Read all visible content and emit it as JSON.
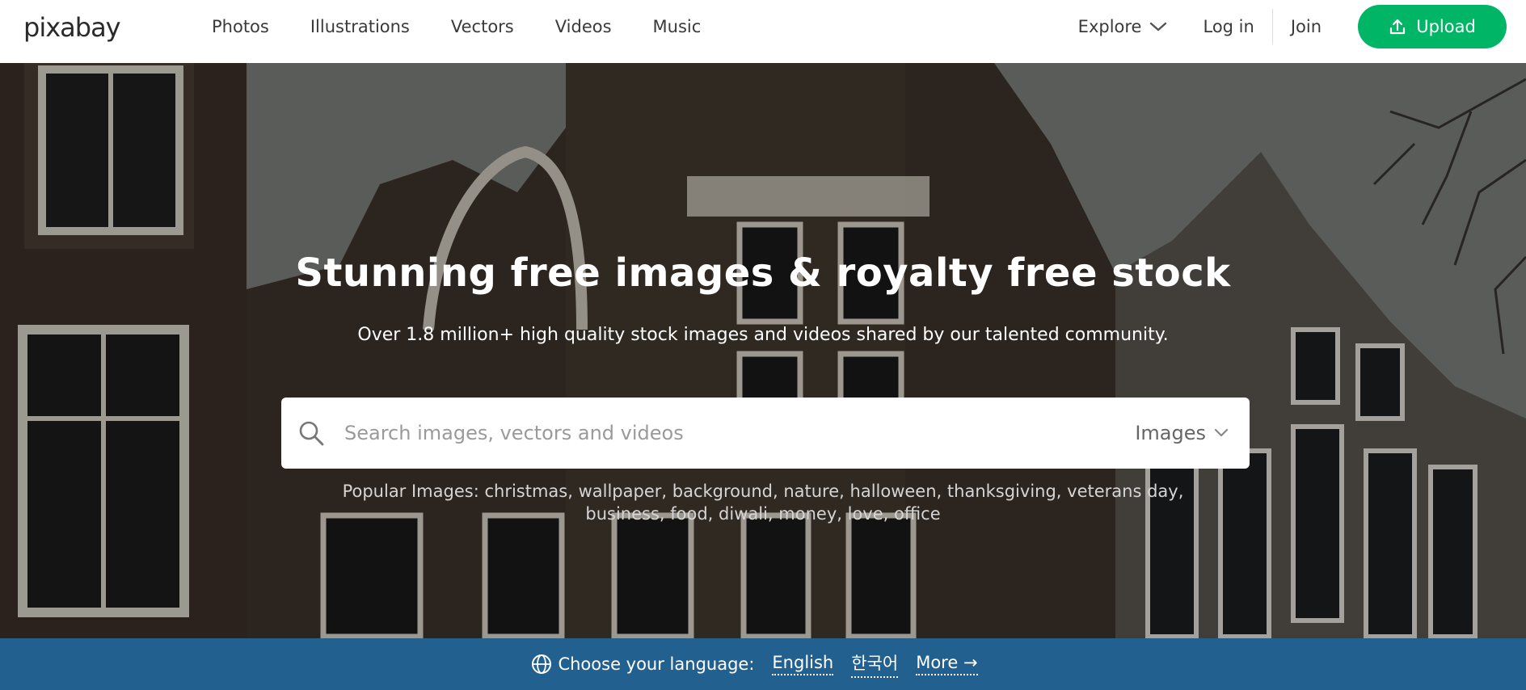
{
  "header": {
    "logo": "pixabay",
    "nav": [
      "Photos",
      "Illustrations",
      "Vectors",
      "Videos",
      "Music"
    ],
    "explore_label": "Explore",
    "login_label": "Log in",
    "join_label": "Join",
    "upload_label": "Upload"
  },
  "hero": {
    "title": "Stunning free images & royalty free stock",
    "subtitle": "Over 1.8 million+ high quality stock images and videos shared by our talented community.",
    "search": {
      "placeholder": "Search images, vectors and videos",
      "type_label": "Images"
    },
    "popular_label": "Popular Images:",
    "popular_tags": [
      "christmas",
      "wallpaper",
      "background",
      "nature",
      "halloween",
      "thanksgiving",
      "veterans day",
      "business",
      "food",
      "diwali",
      "money",
      "love",
      "office"
    ]
  },
  "language_bar": {
    "label": "Choose your language:",
    "options": [
      "English",
      "한국어",
      "More →"
    ]
  },
  "colors": {
    "upload_green": "#00b566",
    "language_bar_blue": "#22618f"
  },
  "icons": {
    "upload": "upload-icon",
    "search": "search-icon",
    "explore": "chevron-down-icon",
    "language": "globe-icon"
  }
}
